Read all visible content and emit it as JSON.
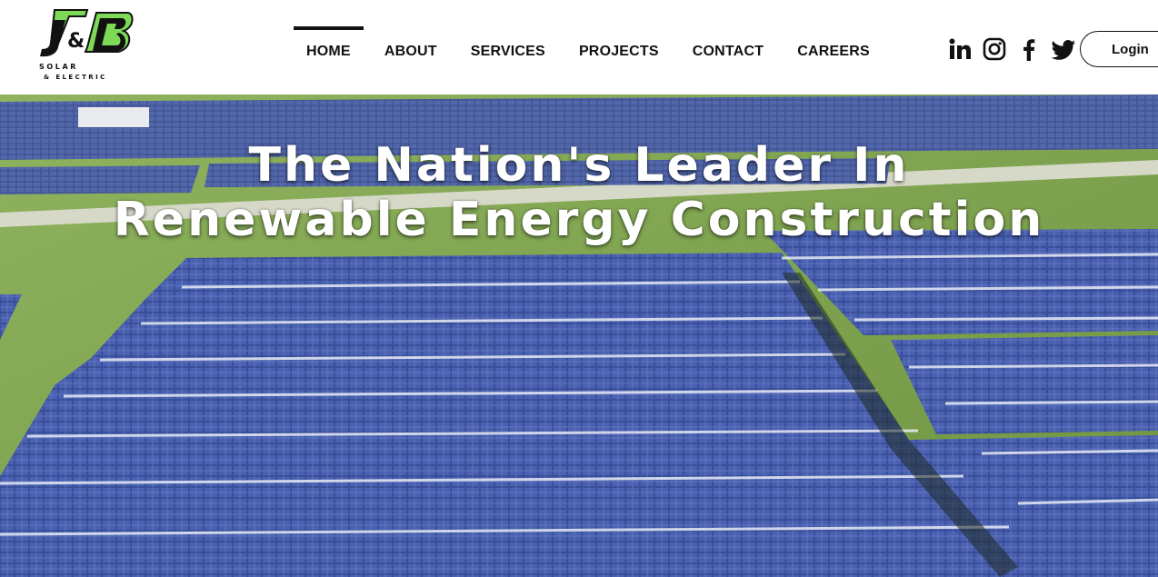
{
  "brand": {
    "logo_mark": "J&B",
    "logo_line1": "SOLAR",
    "logo_line2": "& ELECTRIC",
    "accent": "#7ed957"
  },
  "nav": {
    "items": [
      {
        "label": "HOME",
        "active": true
      },
      {
        "label": "ABOUT",
        "active": false
      },
      {
        "label": "SERVICES",
        "active": false
      },
      {
        "label": "PROJECTS",
        "active": false
      },
      {
        "label": "CONTACT",
        "active": false
      },
      {
        "label": "CAREERS",
        "active": false
      }
    ]
  },
  "social": [
    "linkedin-icon",
    "instagram-icon",
    "facebook-icon",
    "twitter-icon"
  ],
  "login": {
    "label": "Login"
  },
  "hero": {
    "line1": "The Nation's Leader In",
    "line2": "Renewable Energy Construction"
  }
}
